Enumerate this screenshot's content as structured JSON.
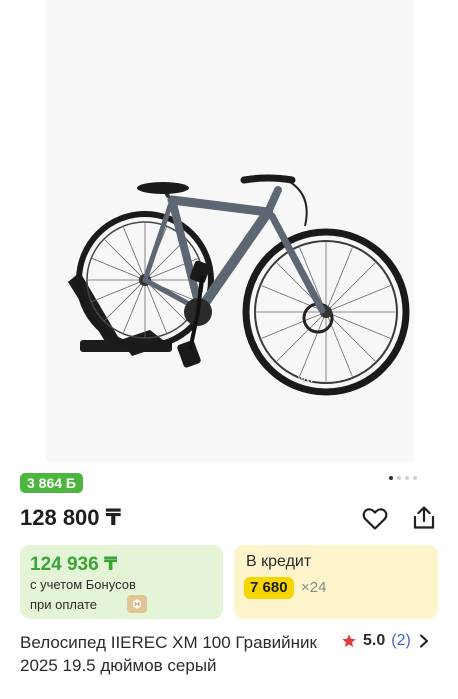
{
  "product": {
    "image_alt": "bicycle-photo",
    "bonus_badge": "3 864 Б",
    "gallery_dots": 4,
    "price": "128 800 ₸",
    "bonus_card": {
      "price": "124 936 ₸",
      "line1": "с учетом Бонусов",
      "line2": "при оплате"
    },
    "credit_card": {
      "title": "В кредит",
      "monthly": "7 680",
      "months": "×24"
    },
    "title": "Велосипед IIEREC XM 100 Гравийник 2025 19.5 дюймов серый",
    "rating": {
      "value": "5.0",
      "count": "(2)"
    }
  },
  "colors": {
    "bonus_green": "#4cb63f",
    "green_card_bg": "#e3f5d6",
    "yellow_card_bg": "#fdf4cc",
    "credit_yellow": "#f6d500",
    "star_red": "#e23b3b",
    "link_blue": "#3f64c9"
  }
}
